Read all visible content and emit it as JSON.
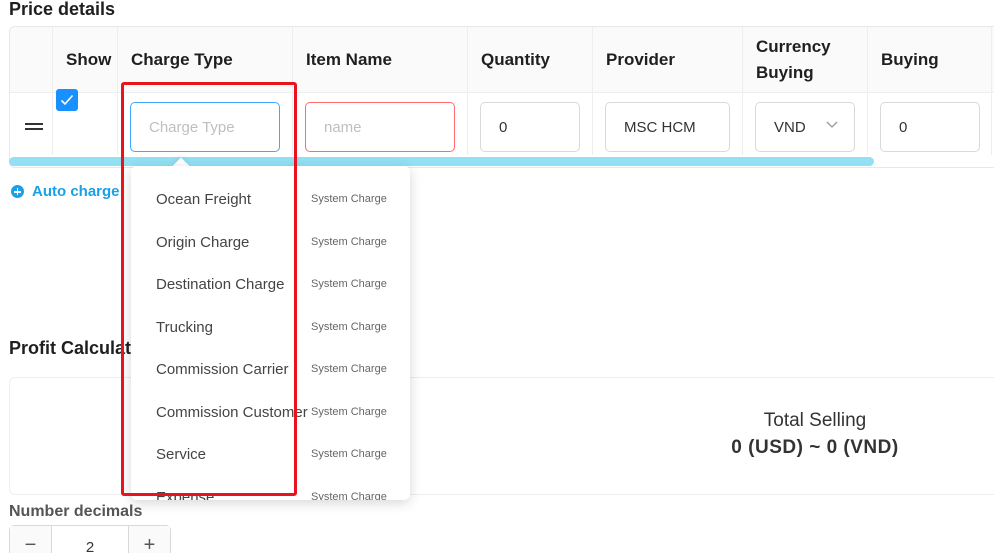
{
  "price_section": {
    "title": "Price details",
    "columns": [
      "Show",
      "Charge Type",
      "Item Name",
      "Quantity",
      "Provider",
      "Currency Buying",
      "Buying"
    ],
    "row": {
      "show_checked": true,
      "charge_type_placeholder": "Charge Type",
      "item_name_placeholder": "name",
      "quantity": "0",
      "provider": "MSC HCM",
      "currency": "VND",
      "buying": "0"
    },
    "auto_charge_label": "Auto charge"
  },
  "charge_dropdown": {
    "items": [
      {
        "name": "Ocean Freight",
        "tag": "System Charge"
      },
      {
        "name": "Origin Charge",
        "tag": "System Charge"
      },
      {
        "name": "Destination Charge",
        "tag": "System Charge"
      },
      {
        "name": "Trucking",
        "tag": "System Charge"
      },
      {
        "name": "Commission Carrier",
        "tag": "System Charge"
      },
      {
        "name": "Commission Customer",
        "tag": "System Charge"
      },
      {
        "name": "Service",
        "tag": "System Charge"
      },
      {
        "name": "Expense",
        "tag": "System Charge"
      }
    ]
  },
  "profit_section": {
    "title": "Profit Calculation",
    "total_selling_label": "Total Selling",
    "total_selling_value": "0 (USD) ~ 0 (VND)"
  },
  "decimals": {
    "label": "Number decimals",
    "value": "2",
    "minus": "−",
    "plus": "+"
  },
  "colors": {
    "accent": "#1890ff",
    "link": "#1aa0e6",
    "highlight": "#e8131d",
    "error_border": "#ff6b6b",
    "scrollbar": "#91e0f4"
  }
}
